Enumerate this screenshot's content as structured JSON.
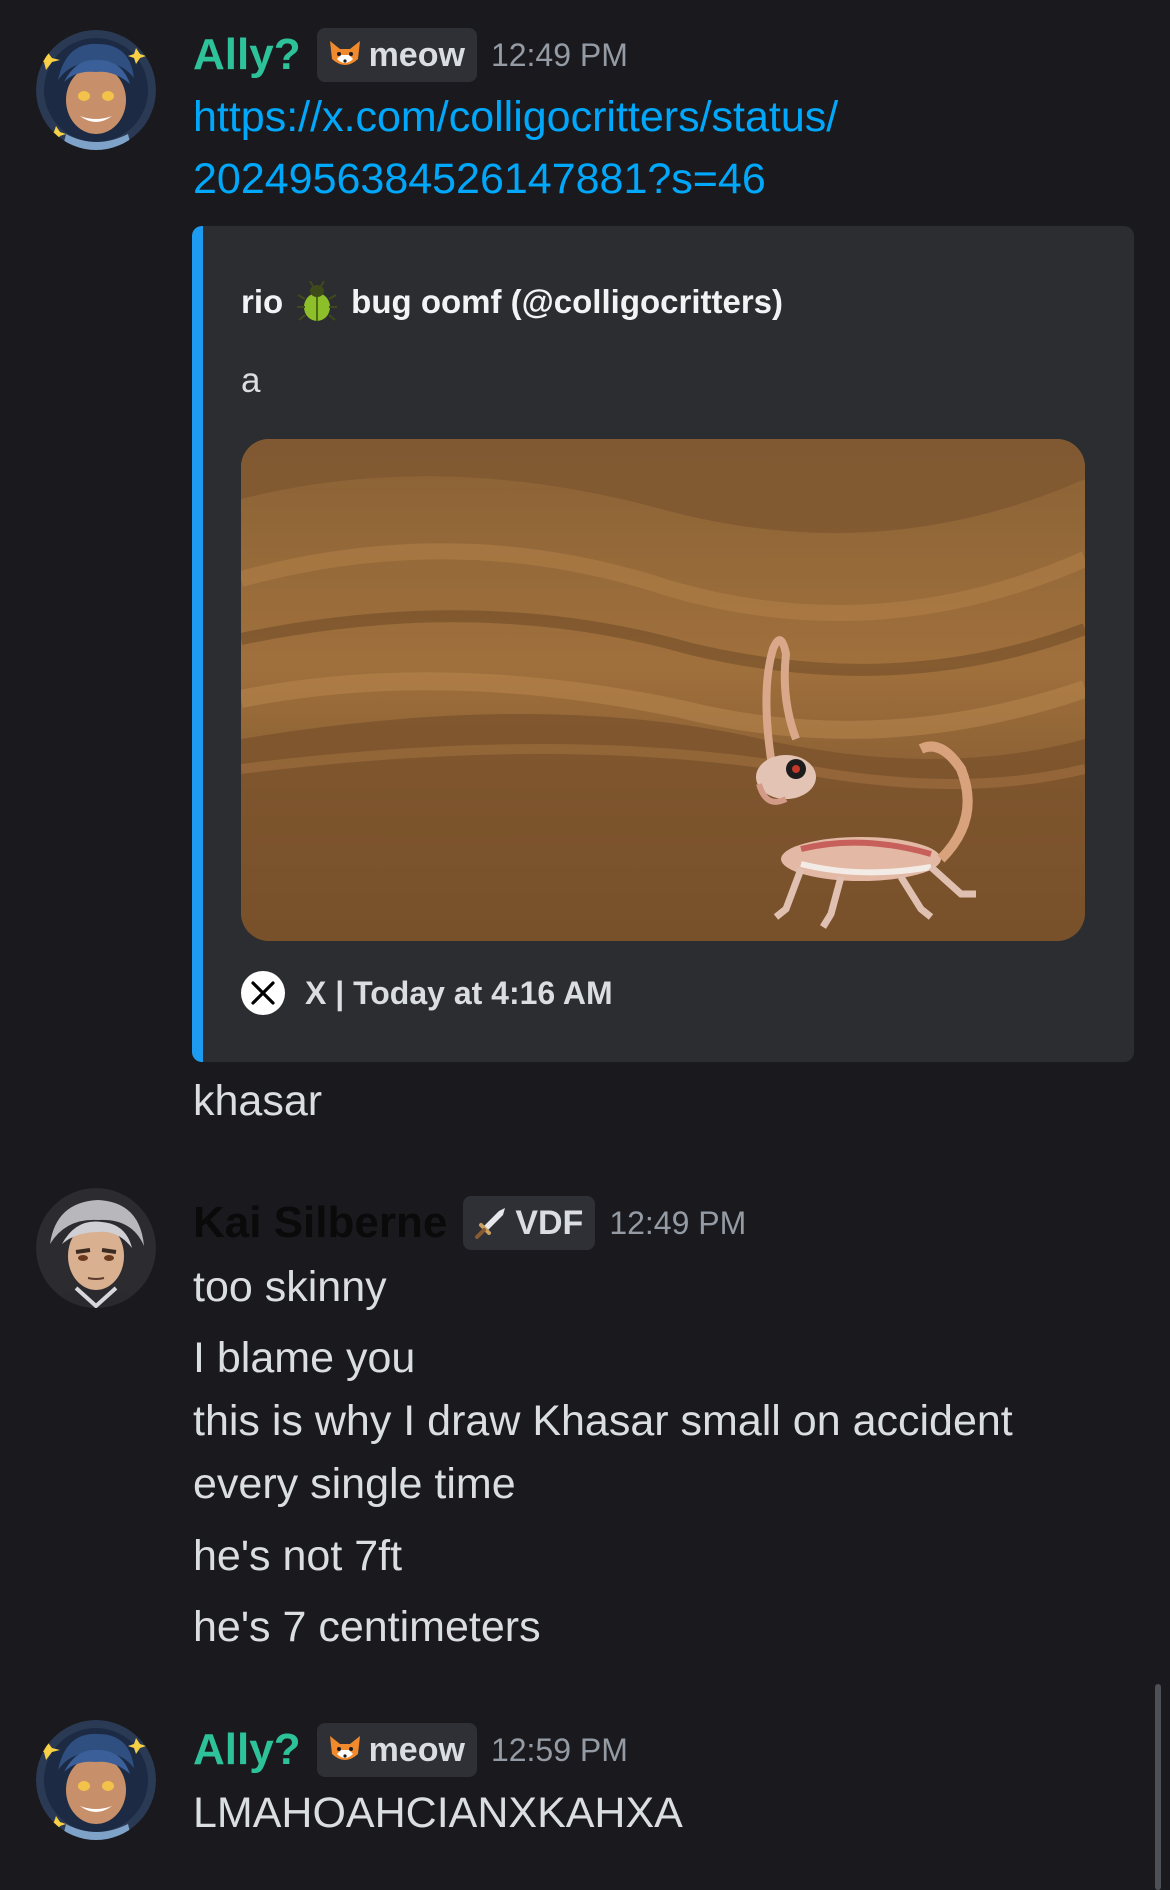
{
  "colors": {
    "background": "#1a1a1e",
    "embed_background": "#2b2d31",
    "embed_accent": "#1d9bf0",
    "link": "#00a8fc",
    "ally_name": "#2dc29a",
    "kai_name": "#0a0a0b",
    "timestamp": "#949ba4"
  },
  "messages": [
    {
      "author": "Ally?",
      "role_tag": "meow",
      "role_icon": "fox-face-icon",
      "timestamp": "12:49 PM",
      "link_line_1": "https://x.com/colligocritters/status/",
      "link_line_2": "2024956384526147881?s=46",
      "embed": {
        "author": "rio",
        "author_emoji": "beetle-icon",
        "author_rest": "bug oomf (@colligocritters)",
        "description": "a",
        "image": "gecko-on-sand-photo",
        "footer": "X | Today at 4:16 AM",
        "footer_icon": "x-logo-icon"
      },
      "followup": "khasar"
    },
    {
      "author": "Kai Silberne",
      "role_tag": "VDF",
      "role_icon": "sword-icon",
      "timestamp": "12:49 PM",
      "lines": [
        "too skinny",
        "I blame you",
        "this is why I draw Khasar small on accident",
        "every single time",
        "he's not 7ft",
        "he's 7 centimeters"
      ]
    },
    {
      "author": "Ally?",
      "role_tag": "meow",
      "role_icon": "fox-face-icon",
      "timestamp": "12:59 PM",
      "lines": [
        "LMAHOAHCIANXKAHXA"
      ]
    }
  ]
}
